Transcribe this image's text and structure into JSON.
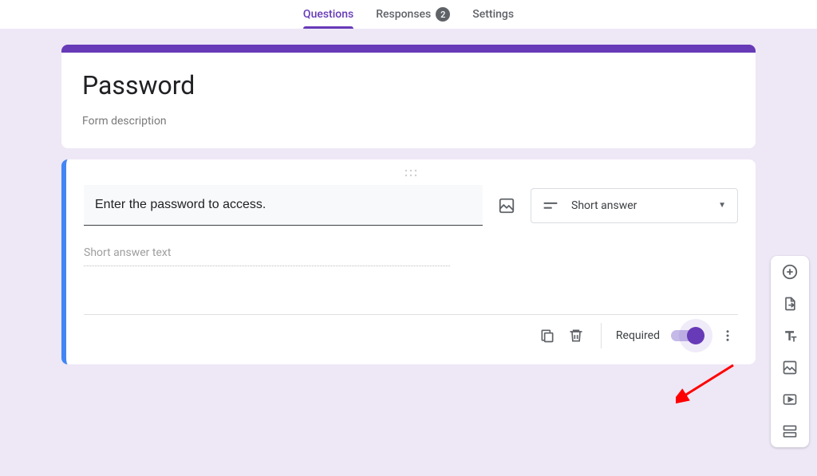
{
  "tabs": {
    "questions": "Questions",
    "responses": "Responses",
    "responses_count": "2",
    "settings": "Settings"
  },
  "form": {
    "title": "Password",
    "description": "Form description"
  },
  "question": {
    "text": "Enter the password to access.",
    "answer_placeholder": "Short answer text",
    "type_label": "Short answer",
    "required_label": "Required",
    "required_on": true
  },
  "toolbar": {
    "add_question": "add-question",
    "import_questions": "import-questions",
    "add_title": "add-title",
    "add_image": "add-image",
    "add_video": "add-video",
    "add_section": "add-section"
  }
}
